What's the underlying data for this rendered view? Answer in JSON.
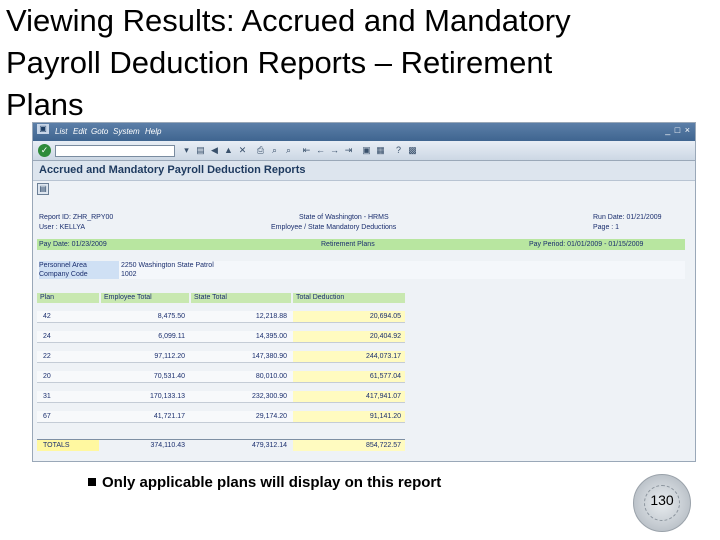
{
  "slide": {
    "title_line1": "Viewing Results: Accrued and Mandatory",
    "title_line2": "Payroll Deduction Reports – Retirement",
    "title_line3": "Plans",
    "bullet": "Only applicable plans will display on this report",
    "page_number": "130"
  },
  "sap": {
    "menu": [
      "List",
      "Edit",
      "Goto",
      "System",
      "Help"
    ],
    "window_controls": "_ □ ×",
    "enter_icon": "check-icon",
    "screen_title": "Accrued and Mandatory Payroll Deduction Reports",
    "report": {
      "row1_left": "Report ID: ZHR_RPY00",
      "row1_center": "State of Washington - HRMS",
      "row1_right": "Run Date: 01/21/2009",
      "row2_left": "User  : KELLYA",
      "row2_center": "Employee / State Mandatory Deductions",
      "row2_right": "Page   :  1",
      "pay_date": "Pay Date: 01/23/2009",
      "section": "Retirement Plans",
      "pay_period": "Pay Period: 01/01/2009 - 01/15/2009",
      "personnel_area_label": "Personnel Area",
      "personnel_area_value": "2250 Washington State Patrol",
      "company_code_label": "Company Code",
      "company_code_value": "1002"
    },
    "table": {
      "headers": [
        "Plan",
        "Employee Total",
        "State Total",
        "Total Deduction"
      ],
      "rows": [
        [
          "42",
          "8,475.50",
          "12,218.88",
          "20,694.05"
        ],
        [
          "24",
          "6,099.11",
          "14,395.00",
          "20,404.92"
        ],
        [
          "22",
          "97,112.20",
          "147,380.90",
          "244,073.17"
        ],
        [
          "20",
          "70,531.40",
          "80,010.00",
          "61,577.04"
        ],
        [
          "31",
          "170,133.13",
          "232,300.90",
          "417,941.07"
        ],
        [
          "67",
          "41,721.17",
          "29,174.20",
          "91,141.20"
        ]
      ],
      "totals": [
        "TOTALS",
        "374,110.43",
        "479,312.14",
        "854,722.57"
      ]
    }
  }
}
